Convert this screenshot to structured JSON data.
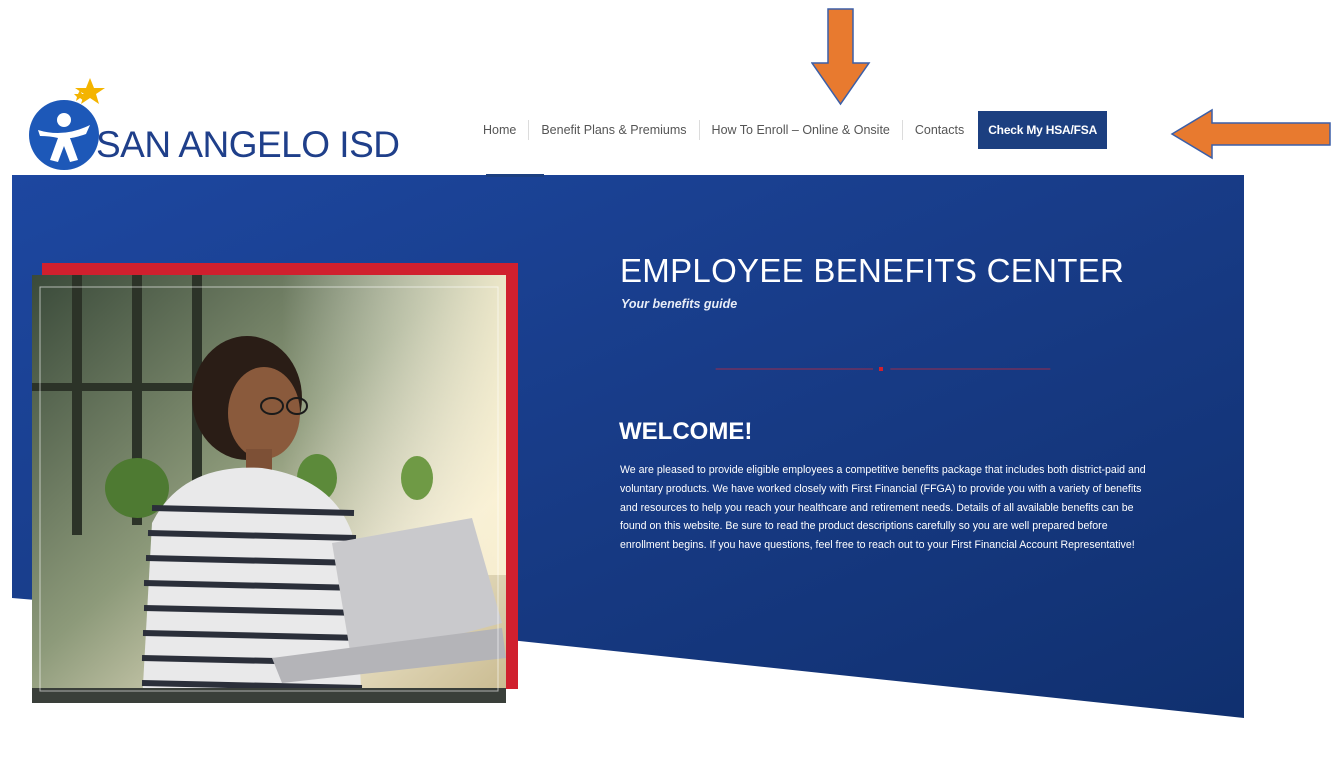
{
  "header": {
    "logo_text": "SAN ANGELO ISD",
    "nav": [
      {
        "label": "Home"
      },
      {
        "label": "Benefit Plans & Premiums"
      },
      {
        "label": "How To Enroll – Online & Onsite"
      },
      {
        "label": "Contacts"
      }
    ],
    "cta_label": "Check My HSA/FSA"
  },
  "hero": {
    "title": "EMPLOYEE BENEFITS CENTER",
    "subtitle": "Your benefits guide",
    "welcome_heading": "WELCOME!",
    "welcome_body": "We are pleased to provide eligible employees a competitive benefits package that includes both district-paid and voluntary products. We have worked closely with First Financial (FFGA) to provide you with a variety of benefits and resources to help you reach your healthcare and retirement needs. Details of all available benefits can be found on this website. Be sure to read the product descriptions carefully so you are well prepared before enrollment begins. If you have questions, feel free to reach out to your First Financial Account Representative!"
  },
  "colors": {
    "brand_navy": "#1c3f80",
    "hero_blue": "#173a84",
    "accent_red": "#d0202e",
    "annotation_orange": "#e87a2f",
    "logo_star": "#f4b400"
  },
  "icons": {
    "logo": "person-with-star-logo",
    "annotation_down": "arrow-down-icon",
    "annotation_left": "arrow-left-icon"
  }
}
